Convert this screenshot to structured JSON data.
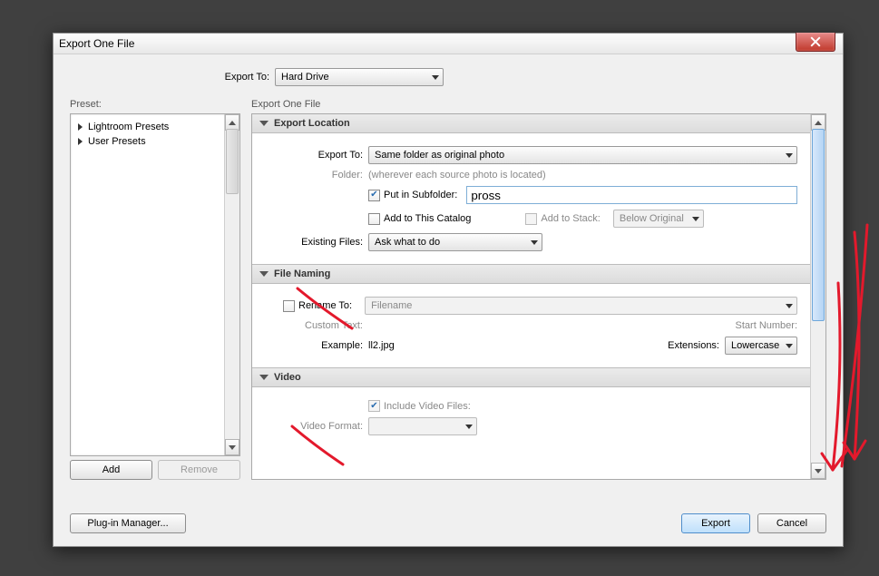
{
  "title": "Export One File",
  "exportTo": {
    "label": "Export To:",
    "value": "Hard Drive"
  },
  "presetLabel": "Preset:",
  "presets": [
    "Lightroom Presets",
    "User Presets"
  ],
  "addBtn": "Add",
  "removeBtn": "Remove",
  "rightLabel": "Export One File",
  "sections": {
    "exportLocation": {
      "title": "Export Location",
      "exportToLbl": "Export To:",
      "exportToVal": "Same folder as original photo",
      "folderLbl": "Folder:",
      "folderVal": "(wherever each source photo is located)",
      "putInSubLbl": "Put in Subfolder:",
      "subfolderVal": "pross",
      "addToCatalogLbl": "Add to This Catalog",
      "addToStackLbl": "Add to Stack:",
      "belowOriginalVal": "Below Original",
      "existingLbl": "Existing Files:",
      "existingVal": "Ask what to do"
    },
    "fileNaming": {
      "title": "File Naming",
      "renameLbl": "Rename To:",
      "renameVal": "Filename",
      "customTextLbl": "Custom Text:",
      "startNumLbl": "Start Number:",
      "exampleLbl": "Example:",
      "exampleVal": "ll2.jpg",
      "extLbl": "Extensions:",
      "extVal": "Lowercase"
    },
    "video": {
      "title": "Video",
      "includeLbl": "Include Video Files:",
      "videoFmtLbl": "Video Format:"
    }
  },
  "footer": {
    "plugin": "Plug-in Manager...",
    "export": "Export",
    "cancel": "Cancel"
  }
}
